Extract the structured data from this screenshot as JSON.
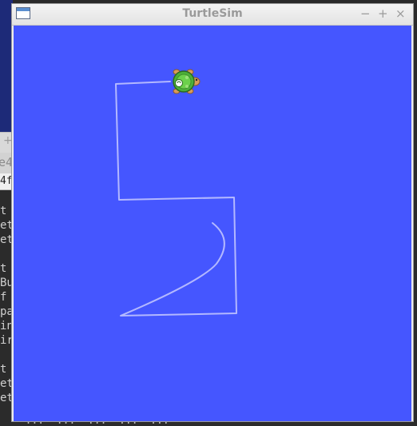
{
  "window": {
    "title": "TurtleSim",
    "minimize_label": "−",
    "maximize_label": "+",
    "close_label": "×"
  },
  "canvas": {
    "background_color": "#4556ff",
    "pen_color": "#b3b8ff"
  },
  "background_terminal": {
    "tab_plus": "+",
    "title_fragment": "e4",
    "tab_fragment": "4f",
    "lines": [
      "t",
      "et",
      "et",
      "",
      "t",
      "Bu",
      "f",
      "pa",
      "in",
      "ir",
      "",
      "t",
      "et",
      "et"
    ],
    "bottom_fragment": "  ...  ...  ...  ...  ..."
  },
  "colors": {
    "titlebar": "#e6e6e6",
    "desktop_navy": "#1d2a78",
    "terminal_bg": "#2b2b2b"
  }
}
